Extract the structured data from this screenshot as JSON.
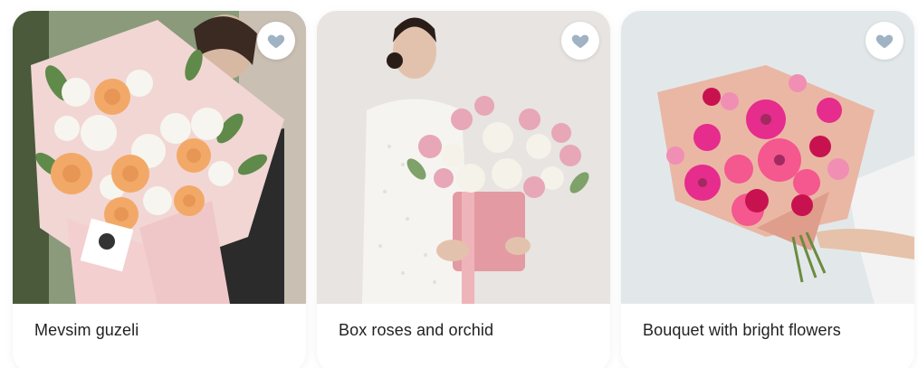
{
  "products": [
    {
      "title": "Mevsim guzeli",
      "favorite_icon": "heart-icon"
    },
    {
      "title": "Box roses and orchid",
      "favorite_icon": "heart-icon"
    },
    {
      "title": "Bouquet with bright flowers",
      "favorite_icon": "heart-icon"
    }
  ],
  "colors": {
    "heart": "#9fb3c4",
    "title_text": "#222222",
    "card_bg": "#ffffff"
  }
}
